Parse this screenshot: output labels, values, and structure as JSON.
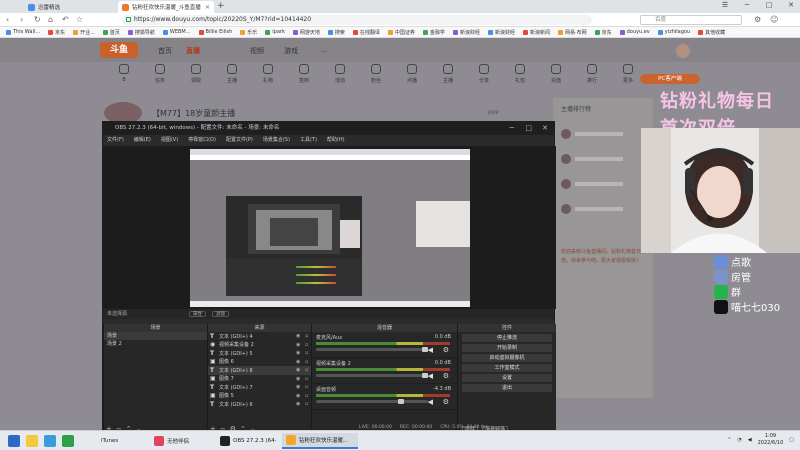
{
  "browser": {
    "tabs": [
      {
        "label": "迅雷精选",
        "active": false
      },
      {
        "label": "钻粉狂欢快乐温暖_斗鱼直播",
        "active": true
      }
    ],
    "url": "https://www.douyu.com/topic/20220S_Y/M7?rid=10414420",
    "search_placeholder": "百度",
    "bookmarks": [
      "This Wall...",
      "京东",
      "开业...",
      "首页",
      "搜狐导航",
      "WEBM...",
      "Billie Eilish",
      "乐乐",
      "ipark",
      "网游天地",
      "搜索",
      "在线翻译",
      "中国证券",
      "金融学",
      "新浪财经",
      "新浪财经",
      "新浪新闻",
      "网易·布网",
      "京东",
      "douyu.ev",
      "yizhilagou",
      "其他收藏"
    ]
  },
  "douyu": {
    "logo": "斗鱼",
    "nav": [
      "首页",
      "直播",
      "视频",
      "游戏",
      "…"
    ],
    "active_nav": "直播",
    "icons": [
      "8",
      "任务",
      "领取",
      "主播",
      "礼物",
      "签到",
      "活动",
      "粉丝",
      "点播",
      "主播",
      "分享",
      "礼包",
      "充值",
      "排行",
      "更多"
    ],
    "pc_button": "PC客户端",
    "room_title": "【M77】18岁童颜主播",
    "room_side": "PPP",
    "side_title": "主播排行榜",
    "side_text": "欢迎来到斗鱼直播间，钻粉礼物首日双倍，快来参与吧，祝大家观看愉快！"
  },
  "overlay": {
    "line1": "钻粉礼物每日",
    "line2": "首次双倍"
  },
  "socials": [
    {
      "icon": "tag-icon",
      "label": "点歌",
      "color": "#6a8fd6"
    },
    {
      "icon": "house-icon",
      "label": "房管",
      "color": "#7b93c9"
    },
    {
      "icon": "wechat-icon",
      "label": "群",
      "color": "#24b34d"
    },
    {
      "icon": "tiktok-icon",
      "label": "喵七七030",
      "color": "#111111"
    }
  ],
  "obs": {
    "title": "OBS 27.2.3 (64-bit, windows) - 配置文件: 未命名 - 场景: 未命名",
    "menu": [
      "文件(F)",
      "编辑(E)",
      "视图(V)",
      "停靠窗口(D)",
      "配置文件(P)",
      "场景集合(S)",
      "工具(T)",
      "帮助(H)"
    ],
    "scene_label": "未选择源",
    "prop_buttons": [
      "属性",
      "滤镜"
    ],
    "docks": {
      "scenes": {
        "title": "场景",
        "items": [
          "场景",
          "场景 2"
        ]
      },
      "sources": {
        "title": "来源",
        "items": [
          "文本 (GDI+) 4",
          "视频采集设备 2",
          "文本 (GDI+) 5",
          "图像 6",
          "文本 (GDI+) 8",
          "图像 7",
          "文本 (GDI+) 7",
          "图像 5",
          "文本 (GDI+) 6"
        ]
      },
      "mixer": {
        "title": "混音器",
        "channels": [
          {
            "name": "麦克风/Aux",
            "db": "0.0 dB"
          },
          {
            "name": "视频采集设备 2",
            "db": "0.0 dB"
          },
          {
            "name": "桌面音频",
            "db": "-4.3 dB"
          }
        ]
      },
      "controls": {
        "title": "控件",
        "buttons": [
          "停止推流",
          "开始录制",
          "启动虚拟摄像机",
          "工作室模式",
          "设置",
          "退出"
        ],
        "tabs": [
          "控件",
          "场景转场"
        ]
      }
    },
    "status": [
      "LIVE: 00:00:00",
      "REC: 00:00:00",
      "CPU: 5.0%, 60.00 fps"
    ]
  },
  "taskbar": {
    "apps": [
      {
        "label": "iTunes",
        "color": "#e9e9e9"
      },
      {
        "label": "无他伴侣",
        "color": "#e2435c"
      },
      {
        "label": "OBS 27.2.3 (64-bi...",
        "color": "#222222"
      },
      {
        "label": "钻粉狂欢快乐温暖...",
        "color": "#f4a62a"
      }
    ],
    "time": "1:09",
    "date": "2022/6/10"
  }
}
